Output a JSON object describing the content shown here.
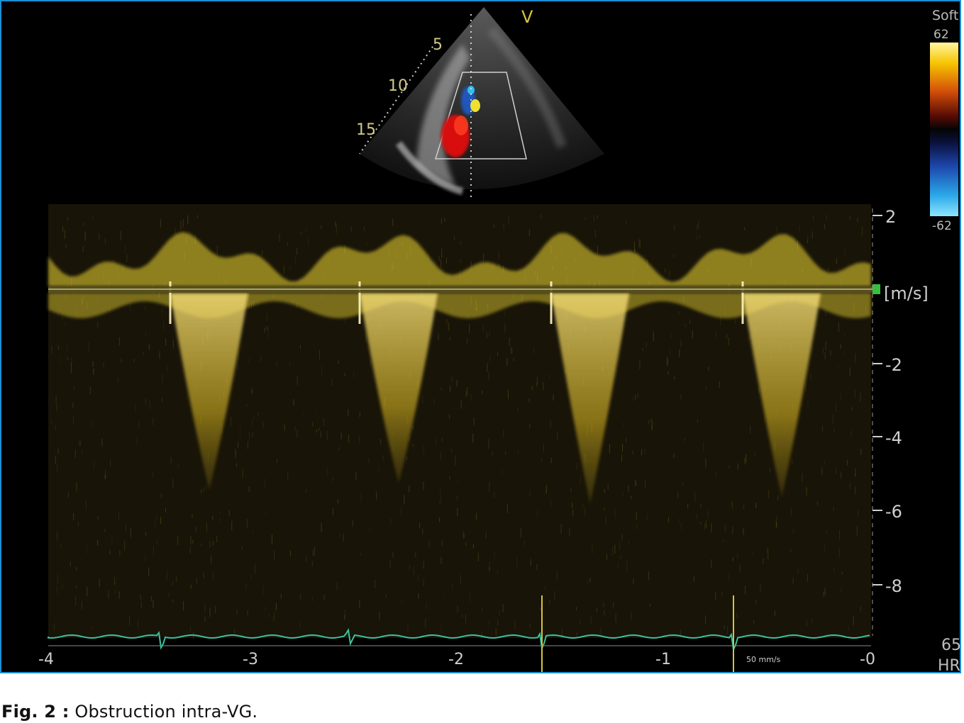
{
  "colorbar": {
    "label": "Soft",
    "max": "62",
    "min": "-62"
  },
  "probe_marker": "V",
  "depth_markers": [
    "5",
    "10",
    "15"
  ],
  "doppler": {
    "unit": "[m/s]",
    "y_ticks": [
      "2",
      "-2",
      "-4",
      "-6",
      "-8"
    ],
    "x_ticks": [
      "-4",
      "-3",
      "-2",
      "-1",
      "-0"
    ],
    "sweep_speed": "50 mm/s",
    "spectrum_color": "#f0d830",
    "ecg_color": "#39c3a0"
  },
  "hr": {
    "value": "65",
    "label": "HR"
  },
  "caption": {
    "prefix": "Fig. 2 :",
    "text": "Obstruction intra-VG."
  }
}
